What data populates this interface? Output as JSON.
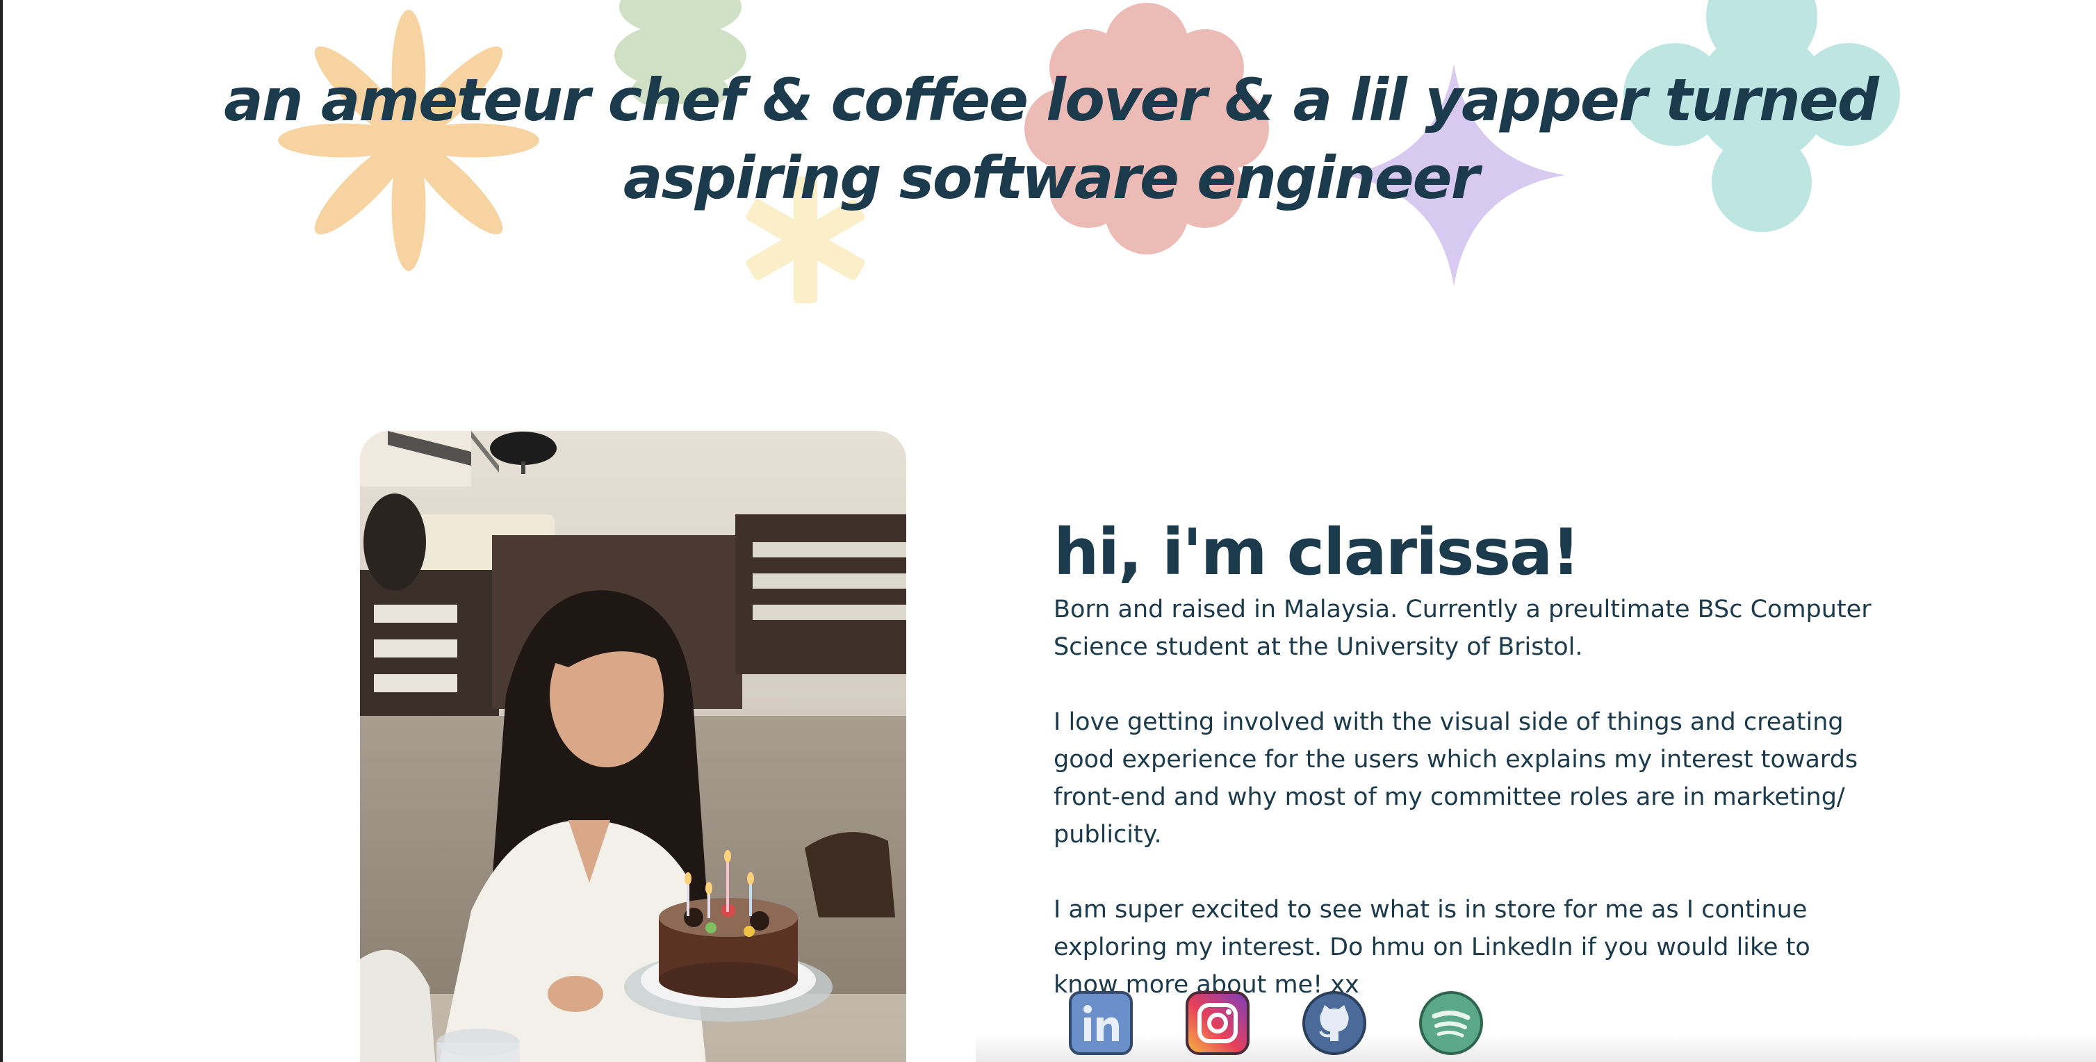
{
  "hero": {
    "line1": "an ameteur chef & coffee lover & a lil yapper turned",
    "line2": "aspiring software engineer"
  },
  "about": {
    "heading": "hi, i'm clarissa!",
    "paragraphs": [
      "Born and raised in Malaysia. Currently a preultimate BSc Computer Science student at the University of Bristol.",
      "I love getting involved with the visual side of things and creating good experience for the users which explains my interest towards front-end and why most of my committee roles are in marketing/ publicity.",
      "I am super excited to see what is in store for me as I continue exploring my interest. Do hmu on LinkedIn if you would like to know more about me! xx"
    ]
  },
  "socials": [
    {
      "icon": "linkedin-icon",
      "color": "#6b8fc9"
    },
    {
      "icon": "instagram-icon",
      "color": "#c13584"
    },
    {
      "icon": "github-icon",
      "color": "#4a6a99"
    },
    {
      "icon": "spotify-icon",
      "color": "#5aa889"
    }
  ],
  "colors": {
    "text": "#1b3a4b",
    "flower_orange": "#f6d3a1",
    "blob_green": "#cfe0c5",
    "blob_pink": "#edbbb6",
    "star_purple": "#d8c9f1",
    "clover_teal": "#bde6e3",
    "asterisk_yellow": "#faefc8"
  }
}
